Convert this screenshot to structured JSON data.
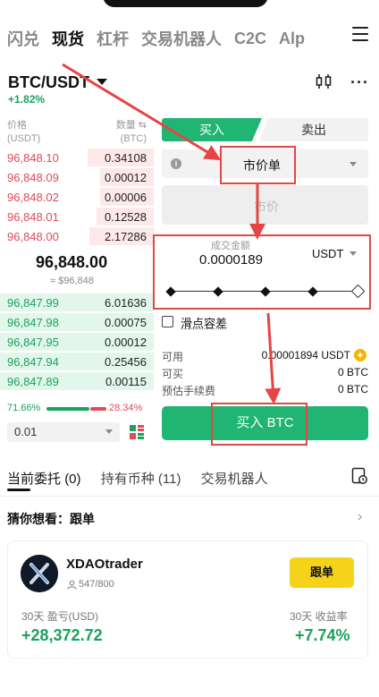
{
  "nav": {
    "tabs": [
      "闪兑",
      "现货",
      "杠杆",
      "交易机器人",
      "C2C",
      "Alp"
    ],
    "active_index": 1,
    "menu_icon": "hamburger-icon"
  },
  "pair": {
    "name": "BTC/USDT",
    "change": "+1.82%",
    "change_color": "#18a35d"
  },
  "orderbook": {
    "price_header": "价格",
    "price_unit": "(USDT)",
    "qty_header": "数量",
    "qty_unit": "(BTC)",
    "asks": [
      {
        "price": "96,848.10",
        "qty": "0.34108"
      },
      {
        "price": "96,848.09",
        "qty": "0.00012"
      },
      {
        "price": "96,848.02",
        "qty": "0.00006"
      },
      {
        "price": "96,848.01",
        "qty": "0.12528"
      },
      {
        "price": "96,848.00",
        "qty": "2.17286"
      }
    ],
    "last_price": "96,848.00",
    "last_price_usd": "≈ $96,848",
    "bids": [
      {
        "price": "96,847.99",
        "qty": "6.01636"
      },
      {
        "price": "96,847.98",
        "qty": "0.00075"
      },
      {
        "price": "96,847.95",
        "qty": "0.00012"
      },
      {
        "price": "96,847.94",
        "qty": "0.25456"
      },
      {
        "price": "96,847.89",
        "qty": "0.00115"
      }
    ],
    "buy_ratio": "71.66%",
    "sell_ratio": "28.34%",
    "buy_ratio_value": 71.66,
    "depth": "0.01"
  },
  "trade": {
    "buy_tab": "买入",
    "sell_tab": "卖出",
    "order_type": "市价单",
    "price_placeholder": "市价",
    "amount_label": "成交金额",
    "amount_value": "0.0000189",
    "amount_unit": "USDT",
    "slippage_label": "滑点容差",
    "available_label": "可用",
    "available_value": "0.00001894 USDT",
    "can_buy_label": "可买",
    "can_buy_value": "0 BTC",
    "fee_label": "预估手续费",
    "fee_value": "0 BTC",
    "buy_button": "买入 BTC",
    "buy_color": "#21b573",
    "sell_color": "#e04a5a"
  },
  "bottom": {
    "tabs": [
      "当前委托",
      "持有币种",
      "交易机器人"
    ],
    "tab_counts": [
      "(0)",
      "(11)",
      ""
    ],
    "guess_label": "猜你想看：跟单"
  },
  "copy_trader": {
    "name": "XDAOtrader",
    "followers": "547/800",
    "follow_button": "跟单",
    "pnl_label": "30天 盈亏(USD)",
    "pnl_value": "+28,372.72",
    "roi_label": "30天 收益率",
    "roi_value": "+7.74%"
  }
}
